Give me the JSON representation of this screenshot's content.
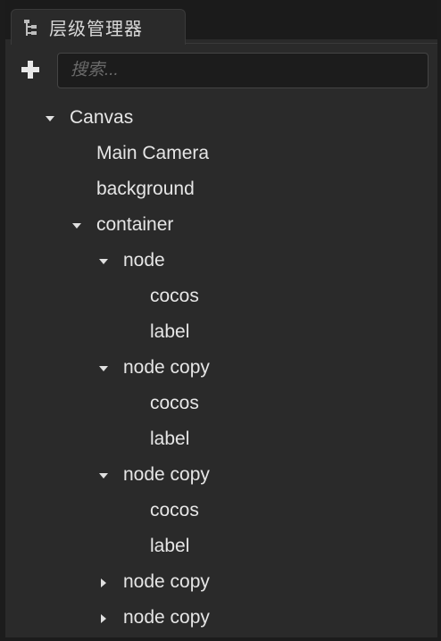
{
  "panel": {
    "title": "层级管理器",
    "icon": "hierarchy-icon"
  },
  "toolbar": {
    "add_icon": "plus-icon",
    "search_placeholder": "搜索..."
  },
  "tree": [
    {
      "label": "Canvas",
      "depth": 0,
      "state": "expanded"
    },
    {
      "label": "Main Camera",
      "depth": 1,
      "state": "leaf"
    },
    {
      "label": "background",
      "depth": 1,
      "state": "leaf"
    },
    {
      "label": "container",
      "depth": 1,
      "state": "expanded"
    },
    {
      "label": "node",
      "depth": 2,
      "state": "expanded"
    },
    {
      "label": "cocos",
      "depth": 3,
      "state": "leaf"
    },
    {
      "label": "label",
      "depth": 3,
      "state": "leaf"
    },
    {
      "label": "node copy",
      "depth": 2,
      "state": "expanded"
    },
    {
      "label": "cocos",
      "depth": 3,
      "state": "leaf"
    },
    {
      "label": "label",
      "depth": 3,
      "state": "leaf"
    },
    {
      "label": "node copy",
      "depth": 2,
      "state": "expanded"
    },
    {
      "label": "cocos",
      "depth": 3,
      "state": "leaf"
    },
    {
      "label": "label",
      "depth": 3,
      "state": "leaf"
    },
    {
      "label": "node copy",
      "depth": 2,
      "state": "collapsed"
    },
    {
      "label": "node copy",
      "depth": 2,
      "state": "collapsed"
    }
  ]
}
